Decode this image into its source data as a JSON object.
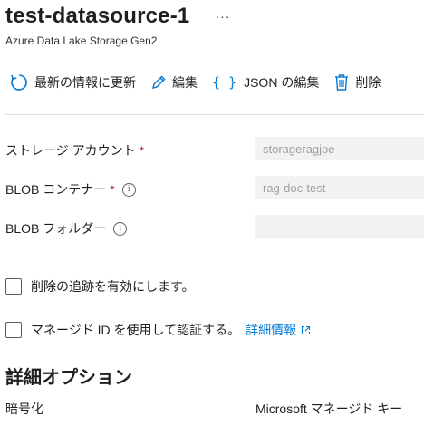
{
  "header": {
    "title": "test-datasource-1",
    "more": "···",
    "subtitle": "Azure Data Lake Storage Gen2"
  },
  "toolbar": {
    "refresh": "最新の情報に更新",
    "edit": "編集",
    "json_edit_icon": "{ }",
    "json_edit": "JSON の編集",
    "delete": "削除"
  },
  "fields": {
    "storage_account": {
      "label": "ストレージ アカウント",
      "required": "*",
      "value": "storageragjpe"
    },
    "blob_container": {
      "label": "BLOB コンテナー",
      "required": "*",
      "value": "rag-doc-test"
    },
    "blob_folder": {
      "label": "BLOB フォルダー",
      "value": ""
    },
    "info_glyph": "i"
  },
  "options": {
    "deletion_tracking": "削除の追跡を有効にします。",
    "managed_id": "マネージド ID を使用して認証する。",
    "learn_more": "詳細情報"
  },
  "advanced": {
    "title": "詳細オプション",
    "encryption_label": "暗号化",
    "encryption_value": "Microsoft マネージド キー"
  },
  "colors": {
    "accent": "#0078d4",
    "required": "#a4262c",
    "input_bg": "#f3f2f1"
  },
  "icons": [
    "refresh-icon",
    "pencil-icon",
    "braces-icon",
    "trash-icon",
    "info-icon",
    "external-link-icon"
  ]
}
